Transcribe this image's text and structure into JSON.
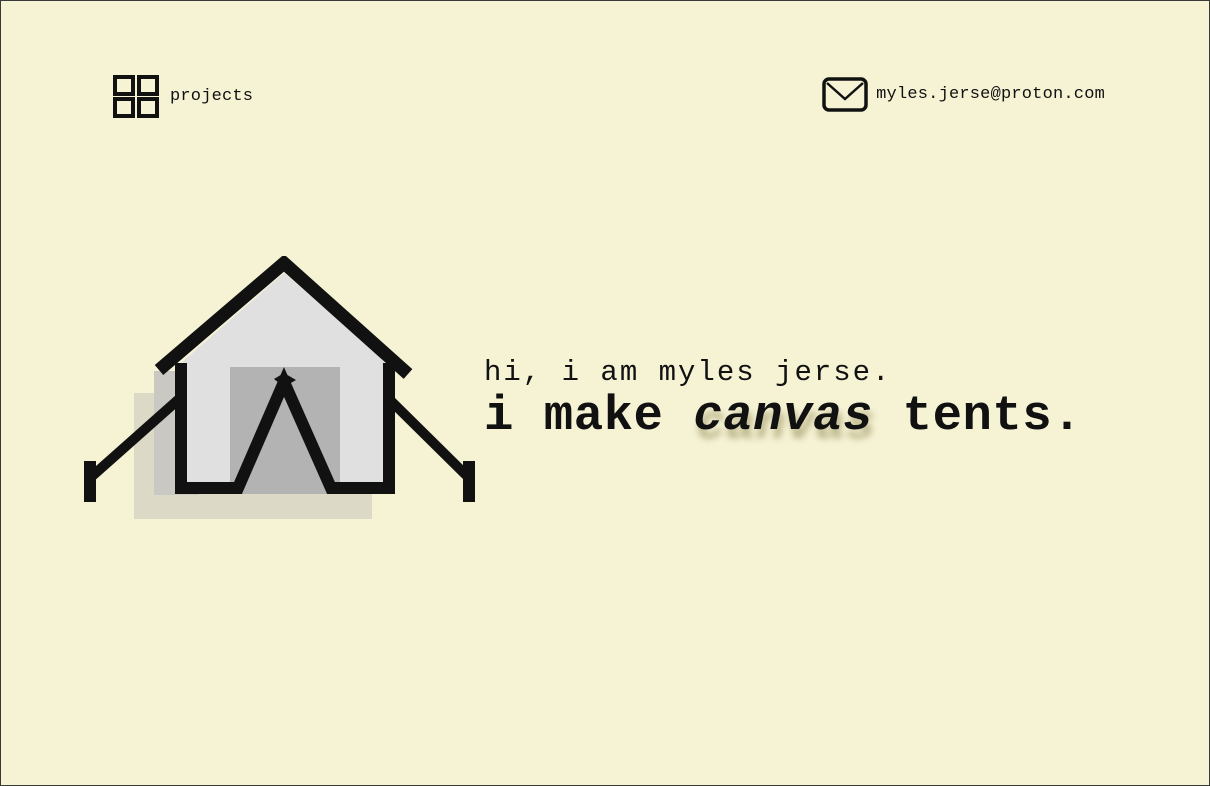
{
  "nav": {
    "projects": {
      "label": "projects",
      "icon": "grid-icon"
    },
    "contact": {
      "label": "myles.jerse@proton.com",
      "icon": "mail-icon"
    }
  },
  "hero": {
    "greeting": "hi, i am myles jerse.",
    "tagline": {
      "before": "i make ",
      "emphasis": "canvas",
      "after": " tents."
    },
    "illustration": {
      "icon": "tent-icon"
    }
  },
  "colors": {
    "background": "#f6f3d5",
    "ink": "#111111",
    "tent_fill": "#e0e0e0",
    "tent_door": "#b3b3b3",
    "shadow_dark": "#c9c8c3",
    "shadow_light": "#dcdac7"
  }
}
